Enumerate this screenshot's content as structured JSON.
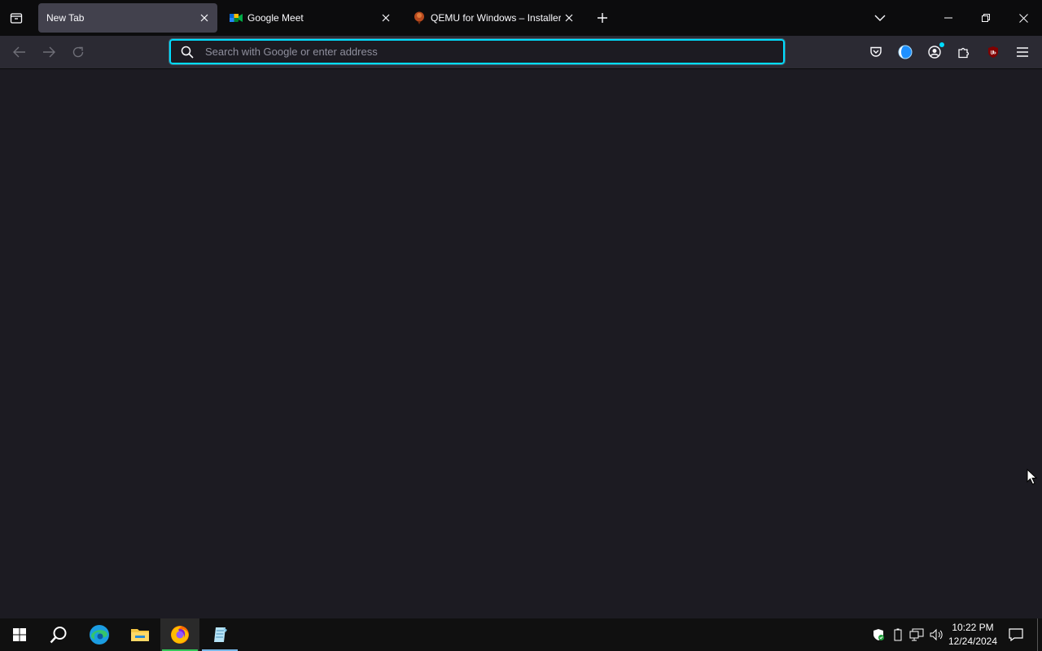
{
  "browser": {
    "tabs": [
      {
        "title": "New Tab",
        "favicon": "none",
        "active": true
      },
      {
        "title": "Google Meet",
        "favicon": "google-meet-icon",
        "active": false
      },
      {
        "title": "QEMU for Windows – Installers",
        "favicon": "qemu-icon",
        "active": false
      }
    ],
    "urlbar": {
      "placeholder": "Search with Google or enter address",
      "value": ""
    },
    "accent_color": "#00ddff"
  },
  "taskbar": {
    "apps": [
      "windows-start-icon",
      "search-icon",
      "edge-icon",
      "file-explorer-icon",
      "firefox-icon",
      "notepad-icon"
    ],
    "clock": {
      "time": "10:22 PM",
      "date": "12/24/2024"
    }
  }
}
